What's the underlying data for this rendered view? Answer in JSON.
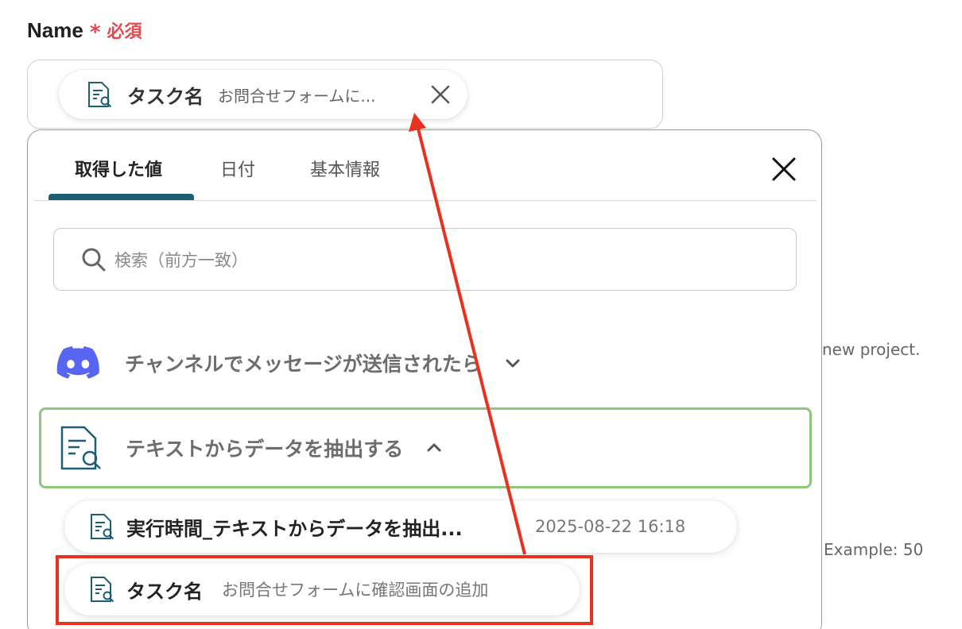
{
  "field": {
    "label": "Name",
    "required_mark": "*",
    "required_text": "必須"
  },
  "selected_chip": {
    "name": "タスク名",
    "value": "お問合せフォームに...",
    "icon": "document-search-icon"
  },
  "panel": {
    "tabs": [
      {
        "label": "取得した値",
        "active": true
      },
      {
        "label": "日付",
        "active": false
      },
      {
        "label": "基本情報",
        "active": false
      }
    ],
    "search_placeholder": "検索（前方一致）",
    "groups": [
      {
        "title": "チャンネルでメッセージが送信されたら",
        "icon": "discord-icon",
        "expanded": false
      },
      {
        "title": "テキストからデータを抽出する",
        "icon": "document-search-icon",
        "expanded": true
      }
    ],
    "items": [
      {
        "name": "実行時間_テキストからデータを抽出...",
        "value": "2025-08-22 16:18"
      },
      {
        "name": "タスク名",
        "value": "お問合せフォームに確認画面の追加"
      }
    ]
  },
  "background_text": {
    "line1": "new project.",
    "line2": "Example: 50"
  },
  "colors": {
    "accent": "#1c5f73",
    "required": "#e5484d",
    "group_highlight": "#8ec77a",
    "annotation": "#e8311f",
    "discord": "#5865f2"
  }
}
